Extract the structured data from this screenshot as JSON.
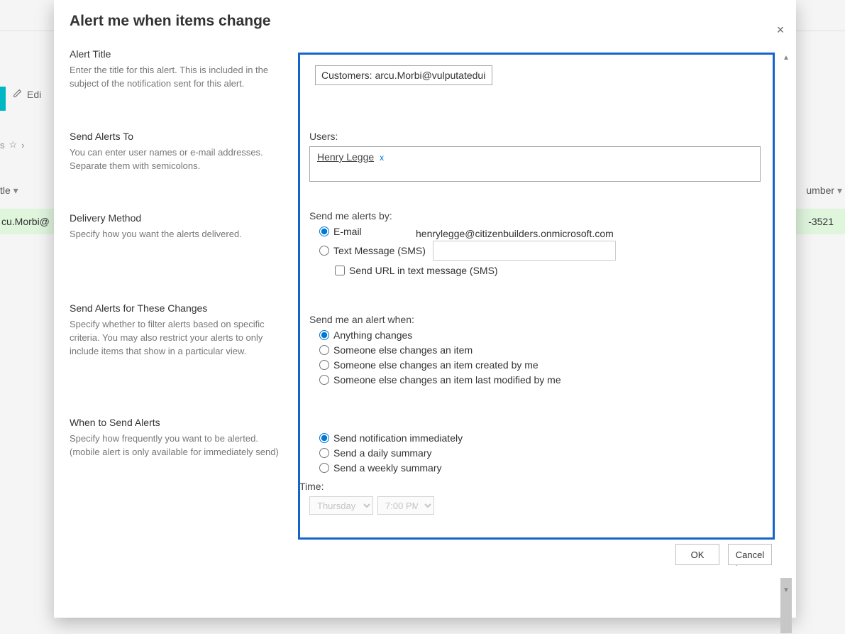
{
  "background": {
    "edit_label": "Edi",
    "star_row_fragment": "s",
    "title_col_fragment": "tle",
    "number_col_fragment": "umber",
    "row_email_fragment": "cu.Morbi@",
    "row_phone_fragment": "-3521"
  },
  "dialog": {
    "title": "Alert me when items change",
    "close": "×",
    "sections": {
      "alert_title": {
        "heading": "Alert Title",
        "desc": "Enter the title for this alert. This is included in the subject of the notification sent for this alert."
      },
      "send_to": {
        "heading": "Send Alerts To",
        "desc": "You can enter user names or e-mail addresses. Separate them with semicolons."
      },
      "delivery": {
        "heading": "Delivery Method",
        "desc": "Specify how you want the alerts delivered."
      },
      "changes": {
        "heading": "Send Alerts for These Changes",
        "desc": "Specify whether to filter alerts based on specific criteria. You may also restrict your alerts to only include items that show in a particular view."
      },
      "when": {
        "heading": "When to Send Alerts",
        "desc": "Specify how frequently you want to be alerted. (mobile alert is only available for immediately send)"
      }
    },
    "form": {
      "title_value": "Customers: arcu.Morbi@vulputateduinec.",
      "users_label": "Users:",
      "users_token": "Henry Legge",
      "users_token_remove": "x",
      "send_by_label": "Send me alerts by:",
      "email_option": "E-mail",
      "email_value": "henrylegge@citizenbuilders.onmicrosoft.com",
      "sms_option": "Text Message (SMS)",
      "sms_url_option": "Send URL in text message (SMS)",
      "alert_when_label": "Send me an alert when:",
      "when_opts": [
        "Anything changes",
        "Someone else changes an item",
        "Someone else changes an item created by me",
        "Someone else changes an item last modified by me"
      ],
      "freq_opts": [
        "Send notification immediately",
        "Send a daily summary",
        "Send a weekly summary"
      ],
      "time_label": "Time:",
      "time_day": "Thursday",
      "time_hour": "7:00 PM"
    },
    "buttons": {
      "ok": "OK",
      "cancel": "Cancel"
    }
  }
}
